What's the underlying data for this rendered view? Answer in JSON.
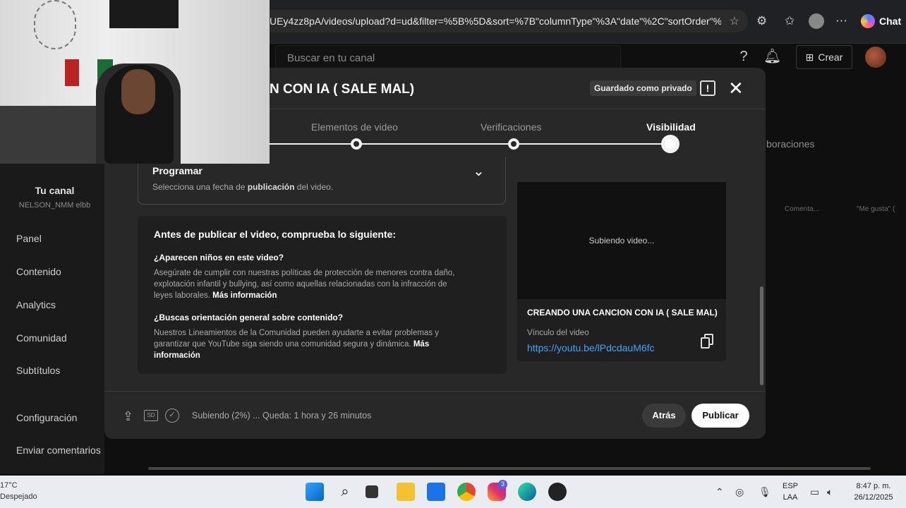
{
  "browser": {
    "url": "UEy4zz8pA/videos/upload?d=ud&filter=%5B%5D&sort=%7B\"columnType\"%3A\"date\"%2C\"sortOrder\"%3...",
    "chat_label": "Chat"
  },
  "header": {
    "search_placeholder": "Buscar en tu canal",
    "create_label": "Crear"
  },
  "sidebar": {
    "channel_name": "Tu canal",
    "channel_handle": "NELSON_NMM elbb",
    "items": [
      "Panel",
      "Contenido",
      "Analytics",
      "Comunidad",
      "Subtítulos"
    ],
    "settings": "Configuración",
    "feedback": "Enviar comentarios"
  },
  "background": {
    "tab": "boraciones",
    "col1": "Comenta...",
    "col2": "\"Me gusta\" (",
    "col2_short": "\"Me gusta\" ("
  },
  "dialog": {
    "title": "N CON IA ( SALE MAL)",
    "saved_badge": "Guardado como privado",
    "steps": [
      "Elementos de video",
      "Verificaciones",
      "Visibilidad"
    ],
    "schedule": {
      "title": "Programar",
      "sub_prefix": "Selecciona una fecha de ",
      "sub_bold": "publicación",
      "sub_suffix": " del video."
    },
    "checklist": {
      "title": "Antes de publicar el video, comprueba lo siguiente:",
      "q1": "¿Aparecen niños en este video?",
      "p1": "Asegúrate de cumplir con nuestras políticas de protección de menores contra daño, explotación infantil y bullying, así como aquellas relacionadas con la infracción de leyes laborales.",
      "p1_link": "Más información",
      "q2": "¿Buscas orientación general sobre contenido?",
      "p2": "Nuestros Lineamientos de la Comunidad pueden ayudarte a evitar problemas y garantizar que YouTube siga siendo una comunidad segura y dinámica.",
      "p2_link": "Más información"
    },
    "preview": {
      "status": "Subiendo video...",
      "title": "CREANDO UNA CANCION CON IA ( SALE MAL)",
      "link_label": "Vínculo del video",
      "link": "https://youtu.be/lPdcdauM6fc"
    },
    "footer": {
      "sd": "SD",
      "status": "Subiendo (2%) ... Queda: 1 hora y 26 minutos",
      "back": "Atrás",
      "publish": "Publicar"
    }
  },
  "taskbar": {
    "temp": "17°C",
    "weather": "Despejado",
    "lang1": "ESP",
    "lang2": "LAA",
    "time": "8:47 p. m.",
    "date": "26/12/2025",
    "badge": "3"
  },
  "colors": {
    "accent_link": "#3ea6ff",
    "dialog_bg": "#282828",
    "page_bg": "#0f0f0f"
  }
}
